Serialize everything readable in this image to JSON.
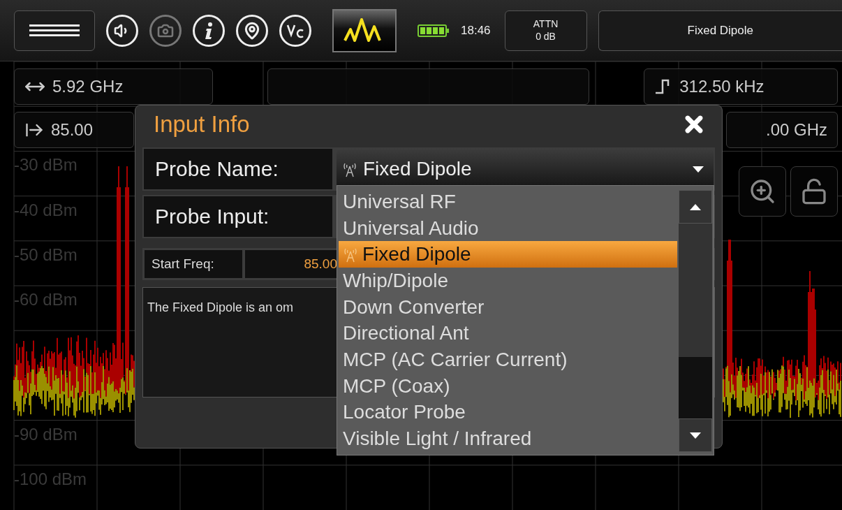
{
  "toolbar": {
    "buttons": [
      {
        "kind": "menu",
        "disabled": false
      },
      {
        "kind": "sound",
        "disabled": false
      },
      {
        "kind": "camera",
        "disabled": true
      },
      {
        "kind": "info",
        "disabled": false
      },
      {
        "kind": "location",
        "disabled": false
      },
      {
        "kind": "remote",
        "disabled": false
      }
    ],
    "mode_button": {
      "selected": true
    },
    "time": "18:46",
    "attenuation": {
      "label": "ATTN",
      "value": "0 dB"
    },
    "probe": "Fixed Dipole"
  },
  "readouts": [
    [
      {
        "kind": "span",
        "value": "5.92 GHz"
      },
      {
        "kind": "center"
      },
      {
        "kind": "rbw",
        "value": "312.50 kHz"
      }
    ],
    [
      {
        "kind": "start",
        "value": "85.00"
      },
      {
        "kind": "stop",
        "value": ".00 GHz"
      }
    ]
  ],
  "side_buttons": [
    {
      "kind": "zoom"
    },
    {
      "kind": "lock"
    }
  ],
  "scale": [
    "-30 dBm",
    "-40 dBm",
    "-50 dBm",
    "-60 dBm",
    "-90 dBm",
    "-100 dBm"
  ],
  "dialog": {
    "title": "Input Info",
    "fields": [
      {
        "label": "Probe Name:",
        "value": "Fixed Dipole"
      },
      {
        "label": "Probe Input:"
      }
    ],
    "start_freq": {
      "label": "Start Freq:",
      "value": "85.00"
    },
    "description": "The Fixed Dipole is an om",
    "dropdown": [
      {
        "label": "Universal RF",
        "selected": false
      },
      {
        "label": "Universal Audio",
        "selected": false
      },
      {
        "label": "Fixed Dipole",
        "selected": true
      },
      {
        "label": "Whip/Dipole",
        "selected": false
      },
      {
        "label": "Down Converter",
        "selected": false
      },
      {
        "label": "Directional Ant",
        "selected": false
      },
      {
        "label": "MCP (AC Carrier Current)",
        "selected": false
      },
      {
        "label": "MCP (Coax)",
        "selected": false
      },
      {
        "label": "Locator Probe",
        "selected": false
      },
      {
        "label": "Visible Light / Infrared",
        "selected": false
      }
    ]
  }
}
